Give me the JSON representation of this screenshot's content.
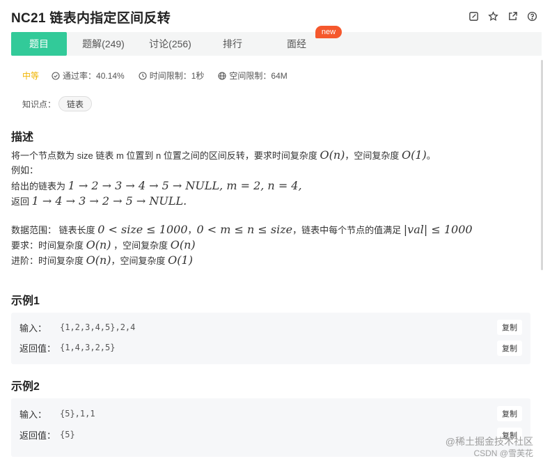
{
  "header": {
    "title": "NC21  链表内指定区间反转",
    "icons": [
      "edit-icon",
      "star-icon",
      "share-icon",
      "help-icon"
    ]
  },
  "tabs": [
    {
      "label": "题目",
      "active": true
    },
    {
      "label": "题解(249)",
      "active": false
    },
    {
      "label": "讨论(256)",
      "active": false
    },
    {
      "label": "排行",
      "active": false
    },
    {
      "label": "面经",
      "active": false
    }
  ],
  "new_badge": "new",
  "meta": {
    "difficulty": "中等",
    "pass_rate": "通过率：40.14%",
    "time_limit": "时间限制：1秒",
    "space_limit": "空间限制：64M"
  },
  "knowledge": {
    "label": "知识点：",
    "tag": "链表"
  },
  "description": {
    "title": "描述",
    "line1_a": "将一个节点数为 size 链表 m 位置到 n 位置之间的区间反转，要求时间复杂度 ",
    "line1_b": "，空间复杂度 ",
    "line1_c": "。",
    "example_label": "例如：",
    "given_prefix": "给出的链表为 ",
    "given_math": "1 → 2 → 3 → 4 → 5 → NULL, m = 2, n = 4,",
    "return_prefix": "返回 ",
    "return_math": "1 → 4 → 3 → 2 → 5 → NULL.",
    "range_a": "数据范围：  链表长度 ",
    "range_math1": "0 < size ≤ 1000",
    "range_b": "，",
    "range_math2": "0 < m ≤ n ≤ size",
    "range_c": "，链表中每个节点的值满足 ",
    "range_math3": "|val| ≤ 1000",
    "req_a": "要求：时间复杂度 ",
    "req_b": " ，空间复杂度 ",
    "adv_a": "进阶：时间复杂度 ",
    "adv_b": "，空间复杂度 ",
    "on": "O(n)",
    "o1": "O(1)"
  },
  "examples": [
    {
      "title": "示例1",
      "input_label": "输入：",
      "input_value": "{1,2,3,4,5},2,4",
      "output_label": "返回值：",
      "output_value": "{1,4,3,2,5}",
      "copy_label": "复制"
    },
    {
      "title": "示例2",
      "input_label": "输入：",
      "input_value": "{5},1,1",
      "output_label": "返回值：",
      "output_value": "{5}",
      "copy_label": "复制"
    }
  ],
  "watermarks": [
    "@稀土掘金技术社区",
    "CSDN @雪芙花"
  ]
}
